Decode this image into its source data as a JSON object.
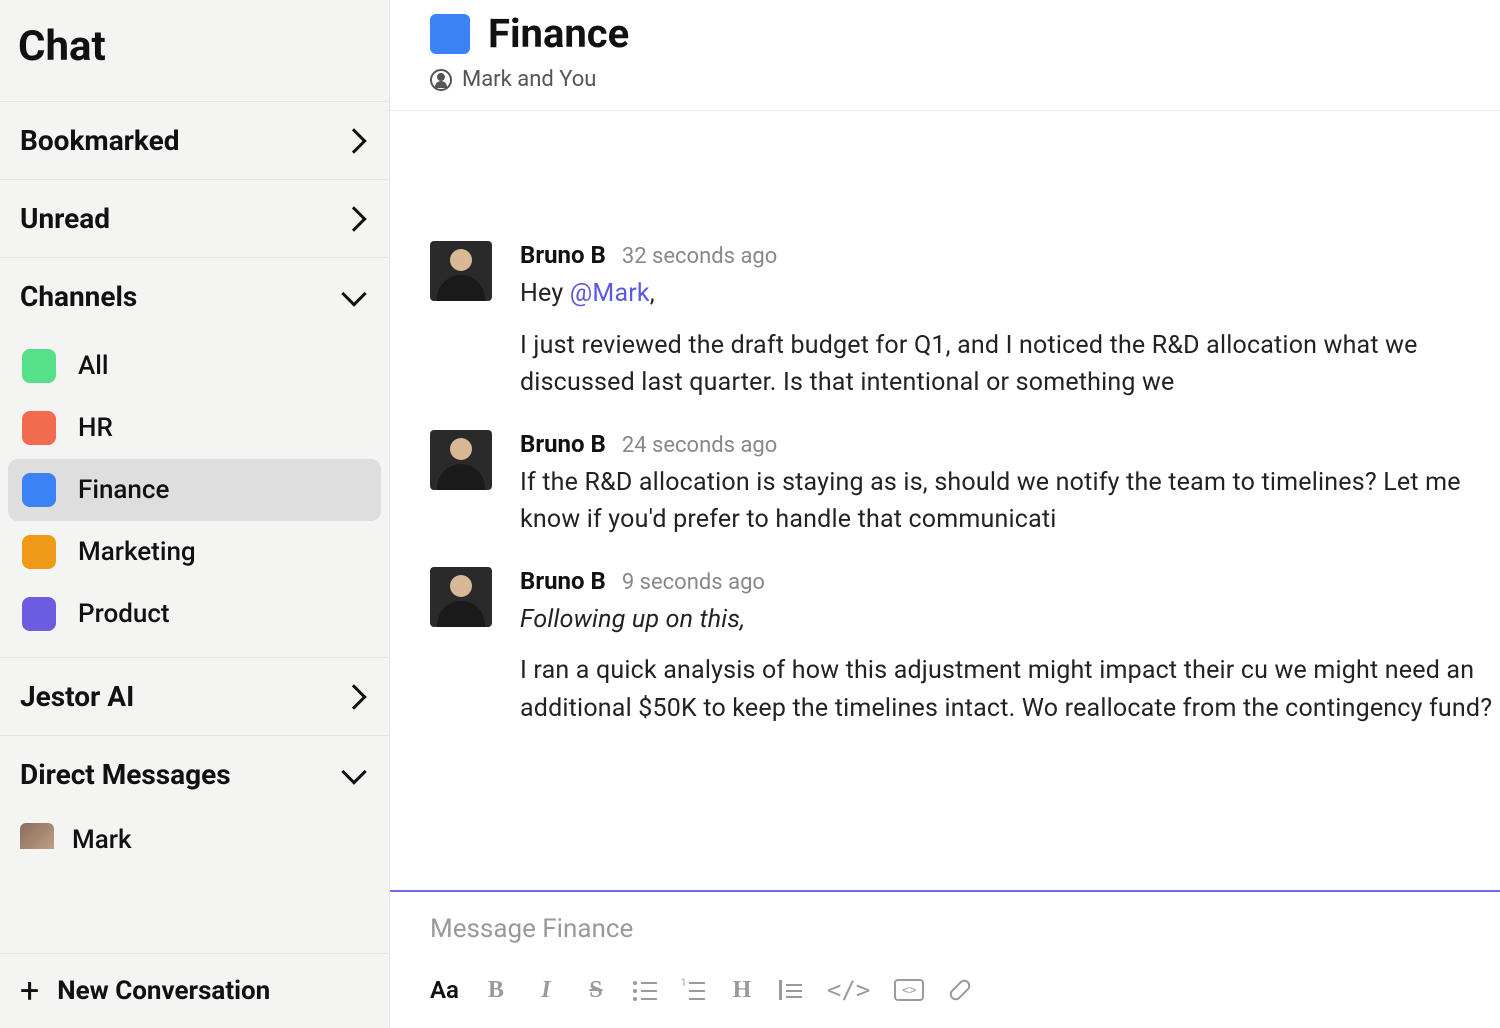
{
  "sidebar": {
    "title": "Chat",
    "sections": {
      "bookmarked": {
        "label": "Bookmarked"
      },
      "unread": {
        "label": "Unread"
      },
      "channels": {
        "label": "Channels",
        "items": [
          {
            "name": "All",
            "color": "#57e08a"
          },
          {
            "name": "HR",
            "color": "#f26b4e"
          },
          {
            "name": "Finance",
            "color": "#3b82f6",
            "active": true
          },
          {
            "name": "Marketing",
            "color": "#f09a1a"
          },
          {
            "name": "Product",
            "color": "#6b5ce0"
          }
        ]
      },
      "jestor_ai": {
        "label": "Jestor AI"
      },
      "direct_messages": {
        "label": "Direct Messages",
        "items": [
          {
            "name": "Mark"
          }
        ]
      }
    },
    "new_conversation": "New Conversation"
  },
  "chat": {
    "title": "Finance",
    "swatch_color": "#3b82f6",
    "subtitle": "Mark and You",
    "messages": [
      {
        "author": "Bruno B",
        "time": "32 seconds ago",
        "mention_prefix": "Hey ",
        "mention": "@Mark",
        "mention_suffix": ",",
        "body": "I just reviewed the draft budget for Q1, and I noticed the R&D allocation what we discussed last quarter. Is that intentional or something we"
      },
      {
        "author": "Bruno B",
        "time": "24 seconds ago",
        "body": "If the R&D allocation is staying as is, should we notify the team to timelines? Let me know if you'd prefer to handle that communicati"
      },
      {
        "author": "Bruno B",
        "time": "9 seconds ago",
        "lead_italic": "Following up on this,",
        "body": "I ran a quick analysis of how this adjustment might impact their cu we might need an additional $50K to keep the timelines intact. Wo reallocate from the contingency fund?"
      }
    ],
    "composer": {
      "placeholder": "Message Finance"
    },
    "toolbar": {
      "format": "Aa",
      "bold": "B",
      "italic": "I",
      "strike": "S",
      "heading": "H",
      "code": "</>",
      "codeblock": "<>"
    }
  }
}
